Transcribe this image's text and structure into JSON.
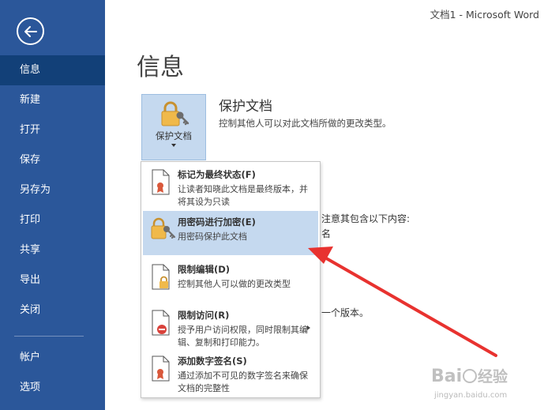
{
  "window": {
    "title": "文档1 - Microsoft Word"
  },
  "sidebar": {
    "back_icon": "back-arrow-icon",
    "items": [
      {
        "label": "信息",
        "active": true
      },
      {
        "label": "新建"
      },
      {
        "label": "打开"
      },
      {
        "label": "保存"
      },
      {
        "label": "另存为"
      },
      {
        "label": "打印"
      },
      {
        "label": "共享"
      },
      {
        "label": "导出"
      },
      {
        "label": "关闭"
      },
      {
        "label": "帐户"
      },
      {
        "label": "选项"
      }
    ]
  },
  "page": {
    "title": "信息"
  },
  "protect": {
    "button_label": "保护文档",
    "section_title": "保护文档",
    "section_desc": "控制其他人可以对此文档所做的更改类型。"
  },
  "background_text": {
    "inspect_line": "注意其包含以下内容:",
    "inspect_sub": "名",
    "versions_line": "一个版本。"
  },
  "menu": {
    "items": [
      {
        "title": "标记为最终状态(F)",
        "desc": "让读者知晓此文档是最终版本，并将其设为只读",
        "icon": "mark-final-document-icon"
      },
      {
        "title": "用密码进行加密(E)",
        "desc": "用密码保护此文档",
        "icon": "lock-key-icon",
        "highlighted": true
      },
      {
        "title": "限制编辑(D)",
        "desc": "控制其他人可以做的更改类型",
        "icon": "restrict-editing-icon"
      },
      {
        "title": "限制访问(R)",
        "desc": "授予用户访问权限，同时限制其编辑、复制和打印能力。",
        "icon": "restrict-access-icon",
        "has_submenu": true
      },
      {
        "title": "添加数字签名(S)",
        "desc": "通过添加不可见的数字签名来确保文档的完整性",
        "icon": "digital-signature-icon"
      }
    ]
  },
  "colors": {
    "sidebar": "#2b579a",
    "sidebar_active": "#124078",
    "highlight": "#c5d9ef",
    "annotation": "#e8322f"
  },
  "watermark": {
    "text": "经验",
    "url": "jingyan.baidu.com",
    "logo": "baidu-logo"
  }
}
